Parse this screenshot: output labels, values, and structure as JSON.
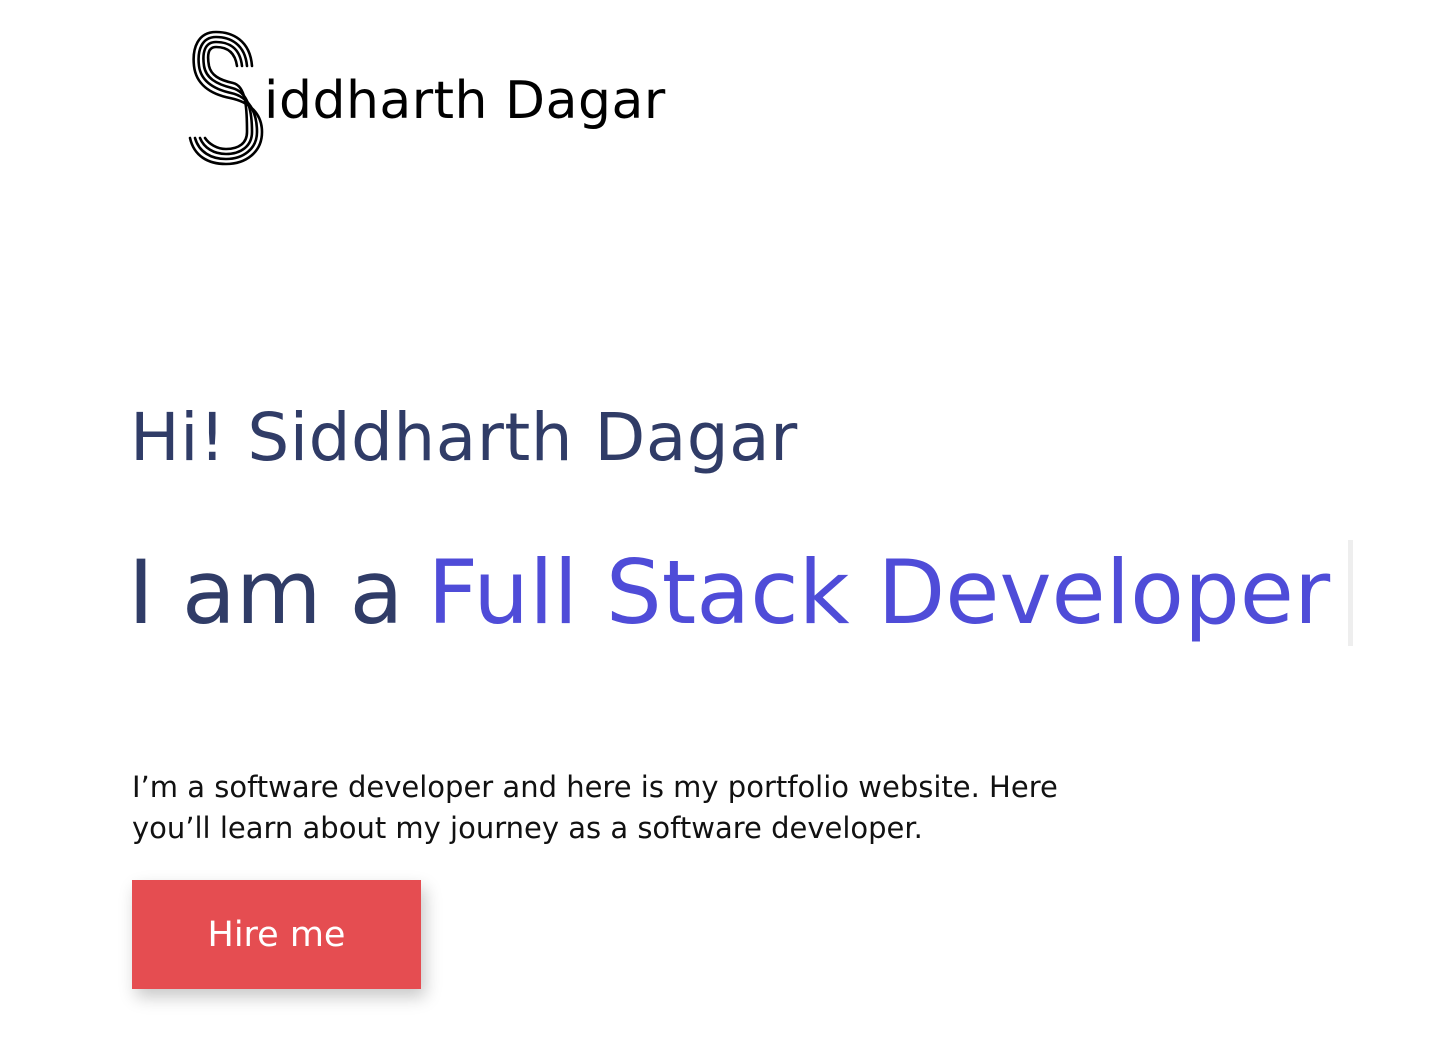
{
  "header": {
    "logo_text": "iddharth Dagar",
    "logo_icon": "stylized-s-icon"
  },
  "hero": {
    "greeting": "Hi! Siddharth Dagar",
    "role_prefix": "I am a",
    "role_value": "Full Stack Developer",
    "intro": "I’m a software developer and here is my portfolio website. Here you’ll learn about my journey as a software developer.",
    "cta_label": "Hire me"
  },
  "colors": {
    "background": "#ffffff",
    "heading": "#303c67",
    "accent": "#4f4cd8",
    "cta": "#e54d51",
    "body_text": "#111111"
  }
}
